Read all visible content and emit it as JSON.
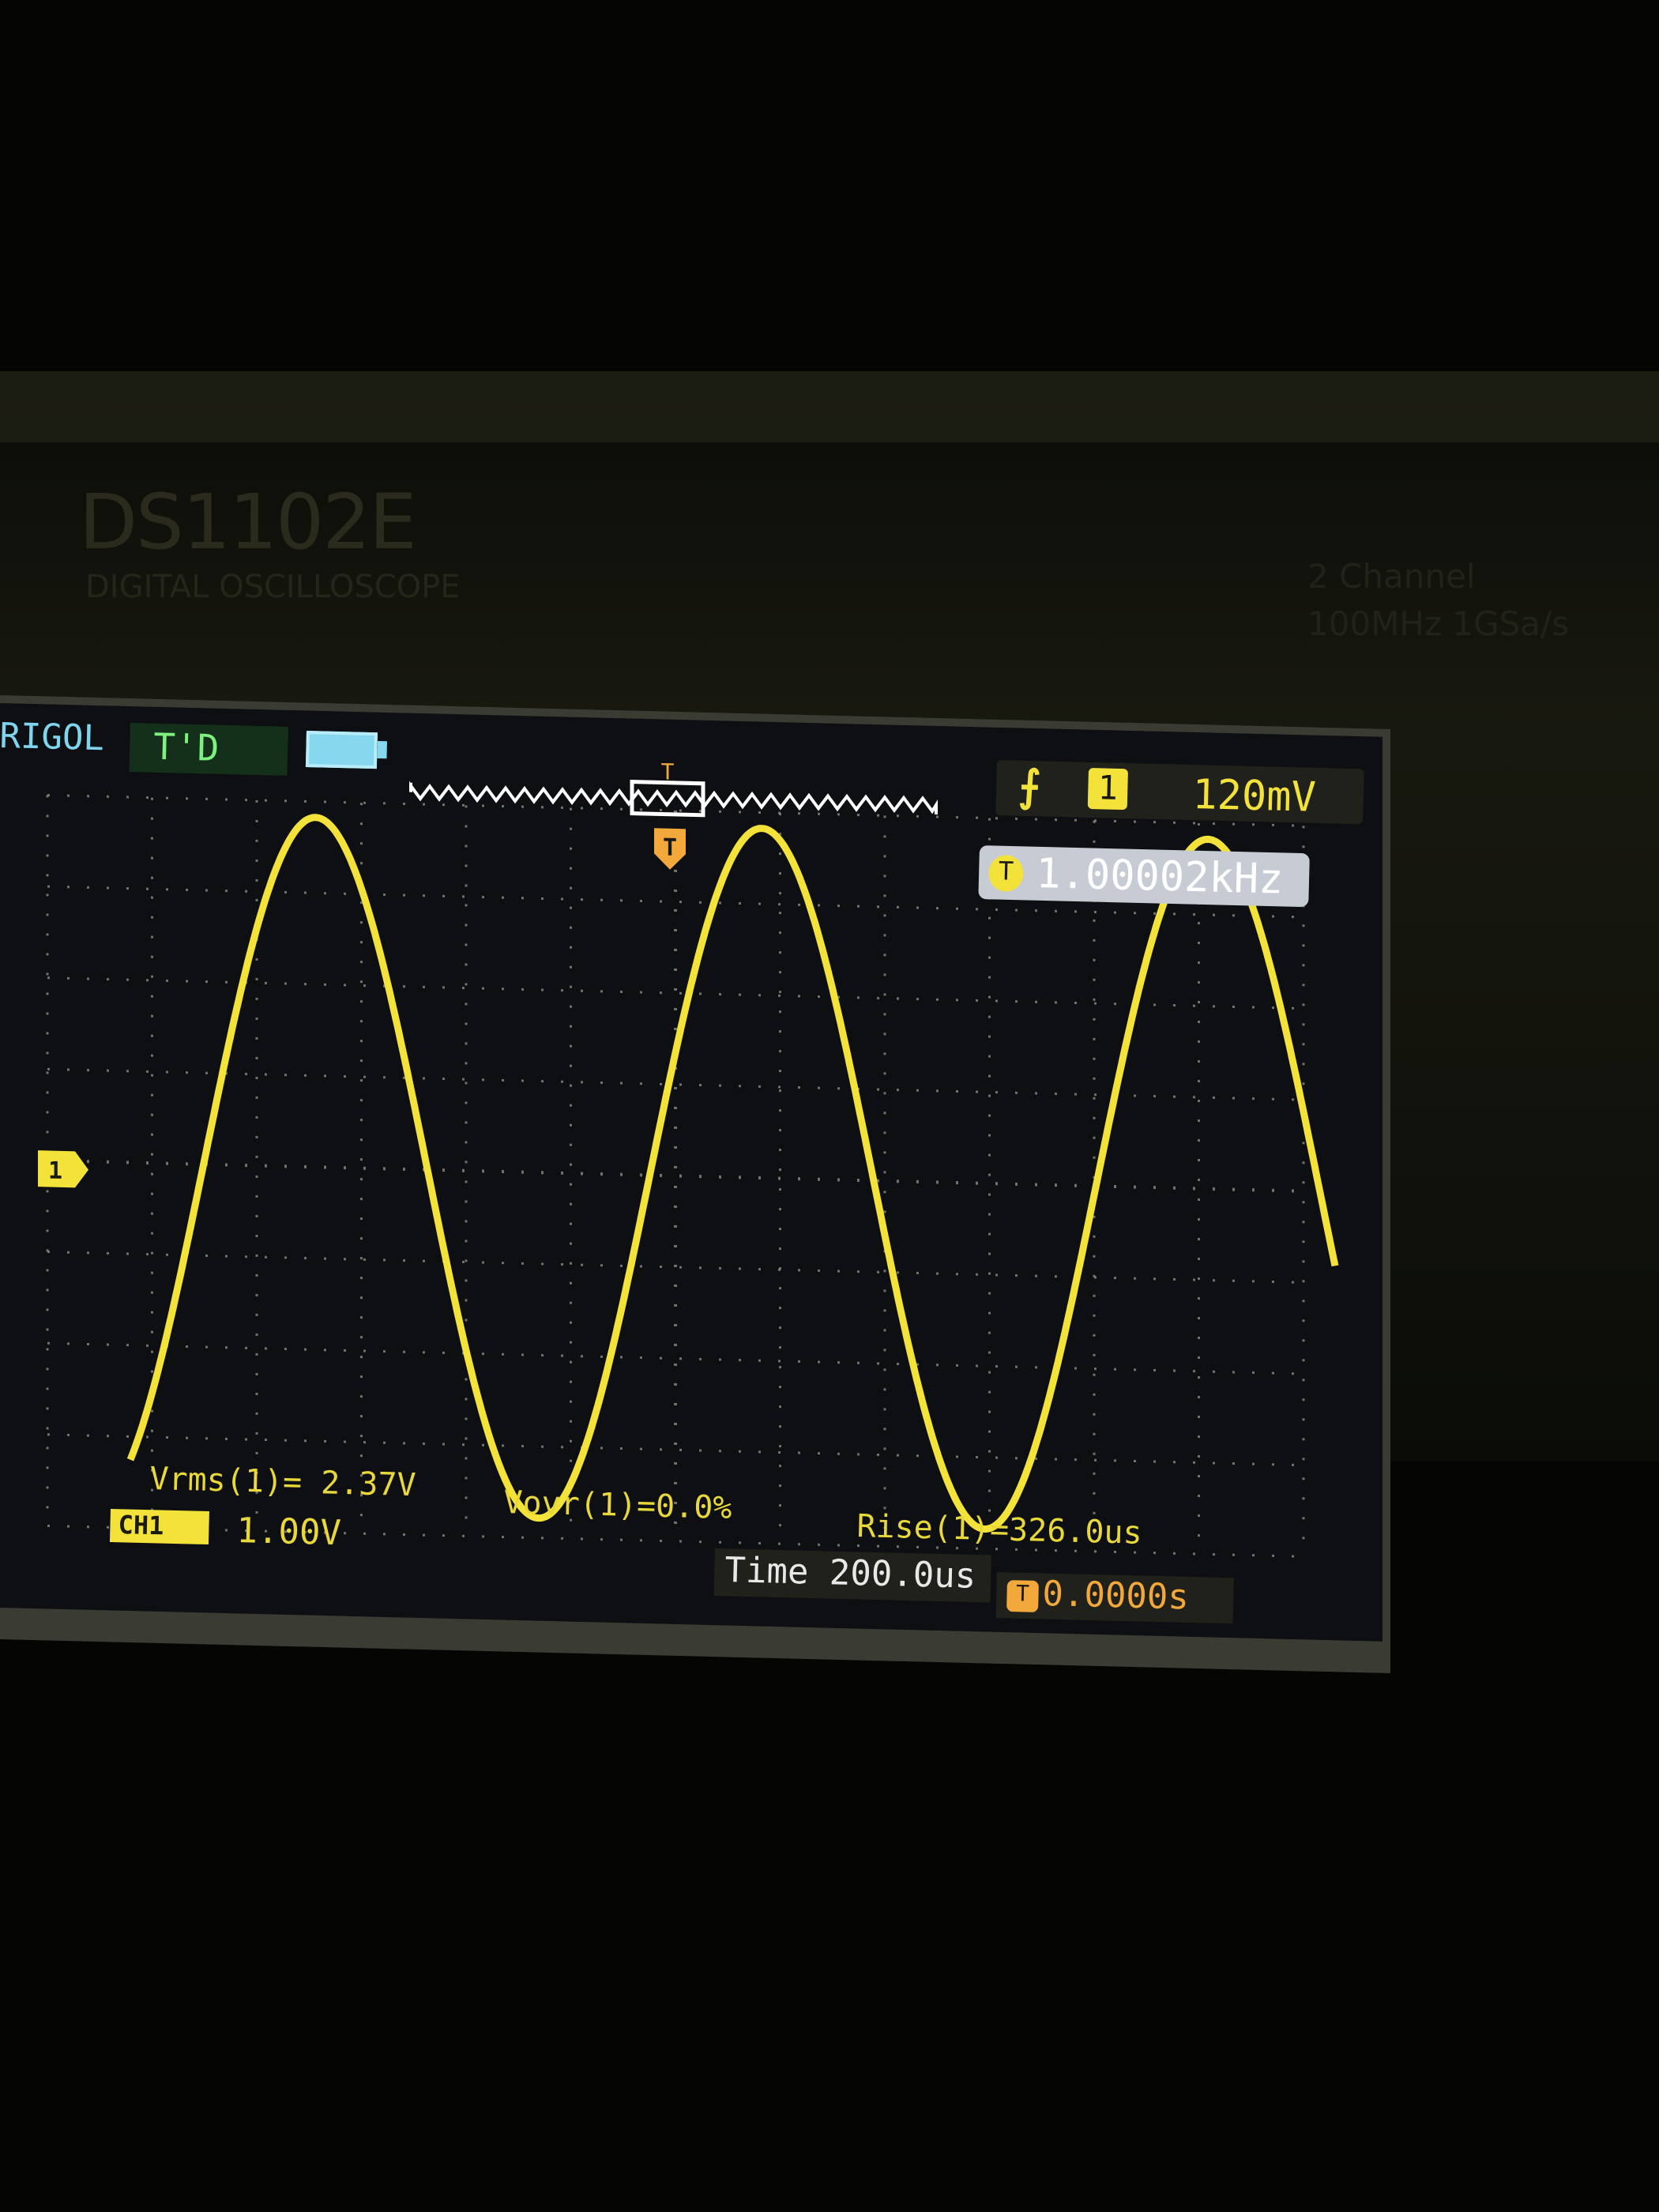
{
  "device": {
    "model": "DS1102E",
    "subtitle": "DIGITAL OSCILLOSCOPE",
    "spec_channels": "2 Channel",
    "spec_bandwidth": "100MHz 1GSa/s"
  },
  "status_bar": {
    "brand": "RIGOL",
    "trigger_status": "T'D",
    "trigger_marker": "T",
    "trigger_edge_icon": "rising-edge-icon",
    "trigger_source": "1",
    "trigger_level": "120mV"
  },
  "frequency_readout": {
    "badge": "T",
    "value": "1.00002kHz"
  },
  "channel_marker": "1",
  "measurements": [
    {
      "text": "Vrms(1)= 2.37V"
    },
    {
      "text": "Vovr(1)=0.0%"
    },
    {
      "text": "Rise(1)=326.0us"
    }
  ],
  "footer": {
    "channel_label": "CH1",
    "channel_scale": "1.00V",
    "timebase": "Time 200.0us",
    "offset_badge": "T",
    "trigger_offset": "0.0000s"
  },
  "colors": {
    "trace": "#f2e23a",
    "screen_bg": "#0e0f12",
    "grid": "#8a8c80",
    "accent_cyan": "#7fd4ee",
    "status_green": "#7df07d"
  },
  "waveform": {
    "type": "sine",
    "frequency_khz": 1.00002,
    "periods_visible": 2.7
  }
}
